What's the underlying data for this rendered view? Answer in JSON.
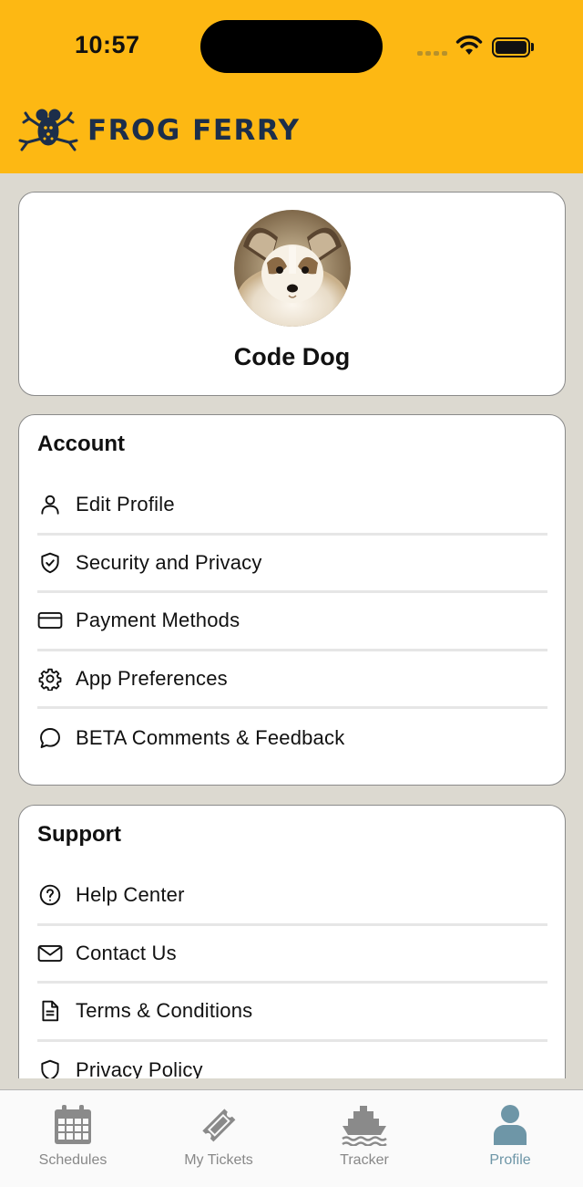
{
  "status_bar": {
    "time": "10:57"
  },
  "header": {
    "brand": "FROG FERRY",
    "brand_color": "#1c2e4a",
    "background": "#fdb813"
  },
  "profile": {
    "name": "Code Dog"
  },
  "account": {
    "title": "Account",
    "items": [
      {
        "label": "Edit Profile",
        "icon": "user-icon"
      },
      {
        "label": "Security and Privacy",
        "icon": "shield-check-icon"
      },
      {
        "label": "Payment Methods",
        "icon": "credit-card-icon"
      },
      {
        "label": "App Preferences",
        "icon": "gear-icon"
      },
      {
        "label": "BETA Comments & Feedback",
        "icon": "chat-bubble-icon"
      }
    ]
  },
  "support": {
    "title": "Support",
    "items": [
      {
        "label": "Help Center",
        "icon": "question-circle-icon"
      },
      {
        "label": "Contact Us",
        "icon": "envelope-icon"
      },
      {
        "label": "Terms & Conditions",
        "icon": "document-icon"
      },
      {
        "label": "Privacy Policy",
        "icon": "shield-icon"
      }
    ]
  },
  "tabs": [
    {
      "label": "Schedules",
      "icon": "calendar-icon",
      "active": false
    },
    {
      "label": "My Tickets",
      "icon": "ticket-icon",
      "active": false
    },
    {
      "label": "Tracker",
      "icon": "ferry-icon",
      "active": false
    },
    {
      "label": "Profile",
      "icon": "person-icon",
      "active": true
    }
  ],
  "colors": {
    "active_tab": "#6e96a7",
    "inactive_tab": "#888888",
    "page_bg": "#dcd9d0"
  }
}
